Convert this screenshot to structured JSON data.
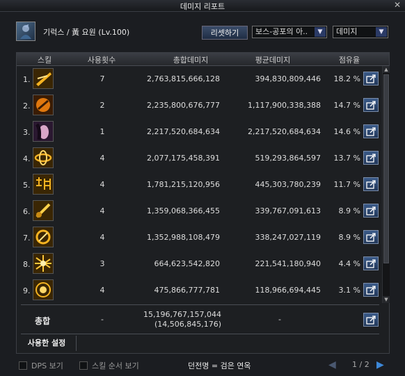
{
  "window": {
    "title": "데미지 리포트"
  },
  "header": {
    "character": "기럭스 / 黃 요원 (Lv.100)",
    "reset_label": "리셋하기",
    "target_select": "보스-공포의 아..",
    "type_select": "데미지"
  },
  "columns": {
    "skill": "스킬",
    "count": "사용횟수",
    "total": "총합데미지",
    "average": "평균데미지",
    "share": "점유율"
  },
  "rows": [
    {
      "rank": "1.",
      "count": "7",
      "total": "2,763,815,666,128",
      "average": "394,830,809,446",
      "share": "18.2 %"
    },
    {
      "rank": "2.",
      "count": "2",
      "total": "2,235,800,676,777",
      "average": "1,117,900,338,388",
      "share": "14.7 %"
    },
    {
      "rank": "3.",
      "count": "1",
      "total": "2,217,520,684,634",
      "average": "2,217,520,684,634",
      "share": "14.6 %"
    },
    {
      "rank": "4.",
      "count": "4",
      "total": "2,077,175,458,391",
      "average": "519,293,864,597",
      "share": "13.7 %"
    },
    {
      "rank": "5.",
      "count": "4",
      "total": "1,781,215,120,956",
      "average": "445,303,780,239",
      "share": "11.7 %"
    },
    {
      "rank": "6.",
      "count": "4",
      "total": "1,359,068,366,455",
      "average": "339,767,091,613",
      "share": "8.9 %"
    },
    {
      "rank": "7.",
      "count": "4",
      "total": "1,352,988,108,479",
      "average": "338,247,027,119",
      "share": "8.9 %"
    },
    {
      "rank": "8.",
      "count": "3",
      "total": "664,623,542,820",
      "average": "221,541,180,940",
      "share": "4.4 %"
    },
    {
      "rank": "9.",
      "count": "4",
      "total": "475,866,777,781",
      "average": "118,966,694,445",
      "share": "3.1 %"
    }
  ],
  "summary": {
    "label": "총합",
    "count": "-",
    "total": "15,196,767,157,044",
    "total_sub": "(14,506,845,176)",
    "average": "-"
  },
  "description_label": "사용한 설정",
  "footer": {
    "dps_label": "DPS 보기",
    "order_label": "스킬 순서 보기",
    "legend": "던전명 = 검은 연옥",
    "page": "1 / 2"
  }
}
